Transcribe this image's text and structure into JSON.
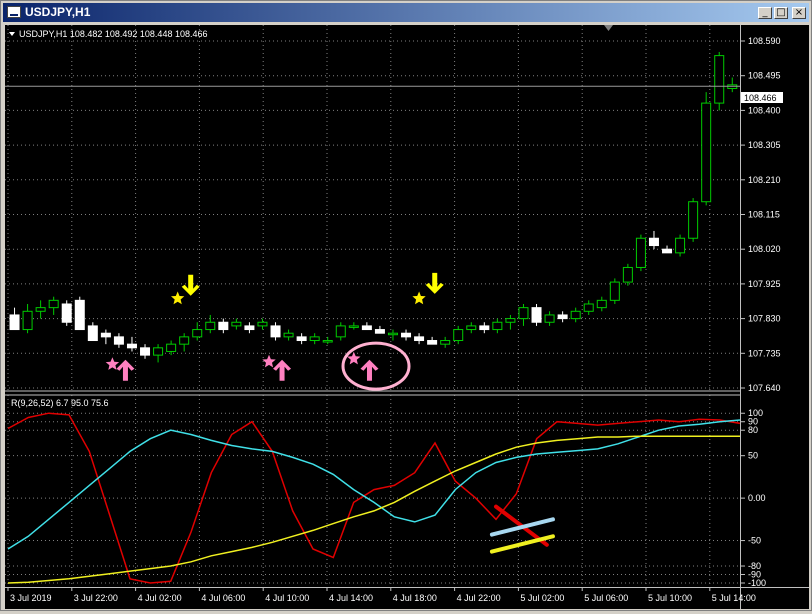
{
  "window": {
    "title": "USDJPY,H1",
    "buttons": {
      "minimize": "_",
      "maximize": "□",
      "close": "×"
    }
  },
  "main_chart": {
    "info": "USDJPY,H1  108.482 108.492 108.448 108.466",
    "current_price": "108.466",
    "price_ticks": [
      "108.590",
      "108.495",
      "108.400",
      "108.305",
      "108.210",
      "108.115",
      "108.020",
      "107.925",
      "107.830",
      "107.735",
      "107.640"
    ]
  },
  "indicator": {
    "label": "R(9,26,52) 6.7 95.0 75.6",
    "ticks": [
      "100",
      "90",
      "80",
      "50",
      "0.00",
      "-50",
      "-80",
      "-90",
      "-100"
    ]
  },
  "time_axis": [
    "3 Jul 2019",
    "3 Jul 22:00",
    "4 Jul 02:00",
    "4 Jul 06:00",
    "4 Jul 10:00",
    "4 Jul 14:00",
    "4 Jul 18:00",
    "4 Jul 22:00",
    "5 Jul 02:00",
    "5 Jul 06:00",
    "5 Jul 10:00",
    "5 Jul 14:00"
  ],
  "colors": {
    "background": "#000000",
    "bull_candle": "#00cc00",
    "bear_candle": "#ffffff",
    "red_line": "#e00000",
    "cyan_line": "#40e0e8",
    "yellow_line": "#f0f020",
    "signal_arrow_up": "#ff80c0",
    "signal_arrow_down": "#ffff00",
    "star": "#ffee00"
  },
  "chart_data": [
    {
      "type": "candlestick",
      "ylim": [
        107.64,
        108.59
      ],
      "candles": [
        [
          107.84,
          107.86,
          107.8,
          107.8
        ],
        [
          107.8,
          107.87,
          107.79,
          107.85
        ],
        [
          107.85,
          107.88,
          107.83,
          107.86
        ],
        [
          107.86,
          107.89,
          107.84,
          107.88
        ],
        [
          107.87,
          107.88,
          107.81,
          107.82
        ],
        [
          107.88,
          107.89,
          107.8,
          107.8
        ],
        [
          107.81,
          107.82,
          107.77,
          107.77
        ],
        [
          107.79,
          107.8,
          107.76,
          107.78
        ],
        [
          107.78,
          107.79,
          107.75,
          107.76
        ],
        [
          107.76,
          107.78,
          107.74,
          107.75
        ],
        [
          107.75,
          107.76,
          107.72,
          107.73
        ],
        [
          107.73,
          107.76,
          107.71,
          107.75
        ],
        [
          107.74,
          107.77,
          107.73,
          107.76
        ],
        [
          107.76,
          107.79,
          107.74,
          107.78
        ],
        [
          107.78,
          107.82,
          107.77,
          107.8
        ],
        [
          107.8,
          107.84,
          107.79,
          107.82
        ],
        [
          107.82,
          107.83,
          107.79,
          107.8
        ],
        [
          107.81,
          107.83,
          107.8,
          107.82
        ],
        [
          107.81,
          107.82,
          107.79,
          107.8
        ],
        [
          107.81,
          107.83,
          107.8,
          107.82
        ],
        [
          107.81,
          107.82,
          107.77,
          107.78
        ],
        [
          107.78,
          107.8,
          107.77,
          107.79
        ],
        [
          107.78,
          107.79,
          107.76,
          107.77
        ],
        [
          107.77,
          107.79,
          107.76,
          107.78
        ],
        [
          107.77,
          107.78,
          107.76,
          107.77
        ],
        [
          107.78,
          107.82,
          107.77,
          107.81
        ],
        [
          107.81,
          107.82,
          107.8,
          107.81
        ],
        [
          107.81,
          107.82,
          107.8,
          107.8
        ],
        [
          107.8,
          107.81,
          107.79,
          107.79
        ],
        [
          107.79,
          107.8,
          107.77,
          107.79
        ],
        [
          107.79,
          107.8,
          107.77,
          107.78
        ],
        [
          107.78,
          107.79,
          107.76,
          107.77
        ],
        [
          107.77,
          107.78,
          107.76,
          107.76
        ],
        [
          107.76,
          107.78,
          107.75,
          107.77
        ],
        [
          107.77,
          107.81,
          107.76,
          107.8
        ],
        [
          107.8,
          107.82,
          107.79,
          107.81
        ],
        [
          107.81,
          107.82,
          107.79,
          107.8
        ],
        [
          107.8,
          107.83,
          107.79,
          107.82
        ],
        [
          107.82,
          107.84,
          107.8,
          107.83
        ],
        [
          107.83,
          107.87,
          107.81,
          107.86
        ],
        [
          107.86,
          107.87,
          107.81,
          107.82
        ],
        [
          107.82,
          107.85,
          107.81,
          107.84
        ],
        [
          107.84,
          107.85,
          107.82,
          107.83
        ],
        [
          107.83,
          107.86,
          107.82,
          107.85
        ],
        [
          107.85,
          107.88,
          107.84,
          107.87
        ],
        [
          107.86,
          107.89,
          107.85,
          107.88
        ],
        [
          107.88,
          107.94,
          107.87,
          107.93
        ],
        [
          107.93,
          107.98,
          107.92,
          107.97
        ],
        [
          107.97,
          108.06,
          107.96,
          108.05
        ],
        [
          108.05,
          108.07,
          108.02,
          108.03
        ],
        [
          108.02,
          108.03,
          108.01,
          108.01
        ],
        [
          108.01,
          108.06,
          108.0,
          108.05
        ],
        [
          108.05,
          108.16,
          108.04,
          108.15
        ],
        [
          108.15,
          108.45,
          108.14,
          108.42
        ],
        [
          108.42,
          108.56,
          108.4,
          108.55
        ],
        [
          108.46,
          108.49,
          108.45,
          108.47
        ]
      ],
      "markers": [
        {
          "kind": "star",
          "color": "pink",
          "index": 7.5,
          "price": 107.705
        },
        {
          "kind": "arrow-up",
          "color": "pink",
          "index": 8.5,
          "price": 107.69
        },
        {
          "kind": "star",
          "color": "yellow",
          "index": 12.5,
          "price": 107.885
        },
        {
          "kind": "arrow-down",
          "color": "yellow",
          "index": 13.5,
          "price": 107.92
        },
        {
          "kind": "star",
          "color": "pink",
          "index": 19.5,
          "price": 107.712
        },
        {
          "kind": "arrow-up",
          "color": "pink",
          "index": 20.5,
          "price": 107.69
        },
        {
          "kind": "star",
          "color": "pink",
          "index": 26.0,
          "price": 107.72
        },
        {
          "kind": "arrow-up",
          "color": "pink",
          "index": 27.2,
          "price": 107.69
        },
        {
          "kind": "star",
          "color": "yellow",
          "index": 31.0,
          "price": 107.885
        },
        {
          "kind": "arrow-down",
          "color": "yellow",
          "index": 32.2,
          "price": 107.925
        }
      ],
      "annotations": [
        {
          "kind": "circle",
          "color": "pink",
          "index": 27.7,
          "price": 107.7
        }
      ]
    },
    {
      "type": "line",
      "ylim": [
        -100,
        105
      ],
      "series": [
        {
          "color": "red",
          "values": [
            82,
            95,
            100,
            98,
            55,
            -20,
            -95,
            -100,
            -98,
            -40,
            30,
            75,
            90,
            55,
            -15,
            -60,
            -70,
            -5,
            10,
            15,
            30,
            65,
            20,
            0,
            -25,
            5,
            70,
            90,
            88,
            86,
            88,
            90,
            92,
            90,
            93,
            92,
            88
          ]
        },
        {
          "color": "cyan",
          "values": [
            -60,
            -45,
            -25,
            -5,
            15,
            35,
            55,
            70,
            80,
            75,
            68,
            62,
            58,
            55,
            48,
            40,
            28,
            10,
            -5,
            -22,
            -28,
            -20,
            10,
            30,
            42,
            48,
            52,
            54,
            56,
            58,
            64,
            72,
            80,
            85,
            87,
            90,
            92
          ]
        },
        {
          "color": "yellow",
          "values": [
            -100,
            -99,
            -97,
            -95,
            -92,
            -89,
            -86,
            -83,
            -80,
            -75,
            -68,
            -63,
            -58,
            -52,
            -45,
            -38,
            -30,
            -22,
            -15,
            -5,
            8,
            20,
            32,
            42,
            52,
            60,
            65,
            68,
            70,
            72,
            72,
            73,
            73,
            73,
            73,
            73,
            73
          ]
        }
      ],
      "annotation_strokes": [
        {
          "color": "red",
          "from": [
            24.0,
            -10
          ],
          "to": [
            26.5,
            -55
          ]
        },
        {
          "color": "light-blue",
          "from": [
            23.8,
            -43
          ],
          "to": [
            26.8,
            -25
          ]
        },
        {
          "color": "yellow",
          "from": [
            23.8,
            -63
          ],
          "to": [
            26.8,
            -45
          ]
        }
      ]
    }
  ]
}
